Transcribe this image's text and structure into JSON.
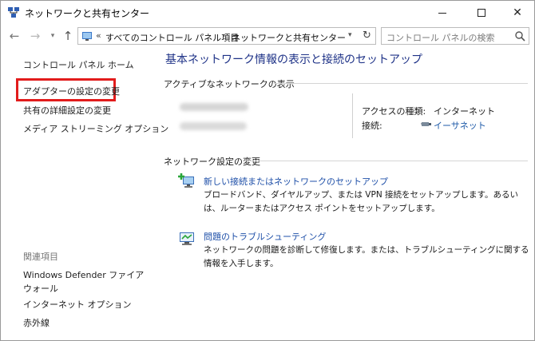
{
  "window": {
    "title": "ネットワークと共有センター",
    "controls": {
      "minimize": "",
      "maximize": "",
      "close": "✕"
    }
  },
  "address_bar": {
    "prefix": "«",
    "crumbs": [
      "すべてのコントロール パネル項目",
      "ネットワークと共有センター"
    ],
    "separator": "›",
    "search_placeholder": "コントロール パネルの検索"
  },
  "sidebar": {
    "home": "コントロール パネル ホーム",
    "items": [
      "アダプターの設定の変更",
      "共有の詳細設定の変更",
      "メディア ストリーミング オプション"
    ],
    "related_header": "関連項目",
    "related": [
      "Windows Defender ファイアウォール",
      "インターネット オプション",
      "赤外線"
    ]
  },
  "main": {
    "title": "基本ネットワーク情報の表示と接続のセットアップ",
    "active_header": "アクティブなネットワークの表示",
    "network": {
      "access_label": "アクセスの種類:",
      "access_value": "インターネット",
      "connection_label": "接続:",
      "connection_value": "イーサネット"
    },
    "change_header": "ネットワーク設定の変更",
    "tasks": [
      {
        "title": "新しい接続またはネットワークのセットアップ",
        "description": "ブロードバンド、ダイヤルアップ、または VPN 接続をセットアップします。あるいは、ルーターまたはアクセス ポイントをセットアップします。"
      },
      {
        "title": "問題のトラブルシューティング",
        "description": "ネットワークの問題を診断して修復します。または、トラブルシューティングに関する情報を入手します。"
      }
    ]
  },
  "colors": {
    "title_blue": "#1e3287",
    "link_blue": "#1e4fa8",
    "highlight_red": "#e21c1c"
  },
  "icons": [
    "network-center-icon",
    "back-arrow-icon",
    "forward-arrow-icon",
    "up-arrow-icon",
    "control-panel-icon",
    "refresh-icon",
    "search-icon",
    "ethernet-icon",
    "new-connection-icon",
    "troubleshoot-icon"
  ]
}
